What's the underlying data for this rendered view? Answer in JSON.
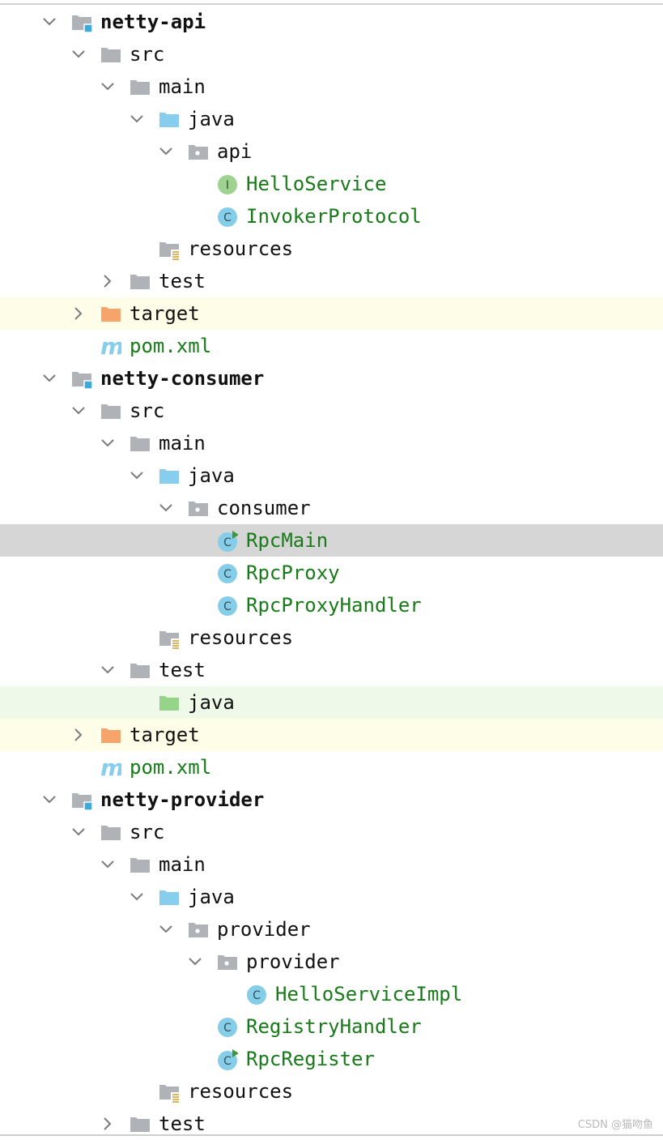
{
  "tree": [
    {
      "label": "netty-api",
      "level": 0,
      "arrow": "down",
      "icon": "module-folder",
      "style": "bold"
    },
    {
      "label": "src",
      "level": 1,
      "arrow": "down",
      "icon": "folder"
    },
    {
      "label": "main",
      "level": 2,
      "arrow": "down",
      "icon": "folder"
    },
    {
      "label": "java",
      "level": 3,
      "arrow": "down",
      "icon": "source-folder"
    },
    {
      "label": "api",
      "level": 4,
      "arrow": "down",
      "icon": "package-folder"
    },
    {
      "label": "HelloService",
      "level": 5,
      "arrow": "none",
      "icon": "interface-icon",
      "style": "class"
    },
    {
      "label": "InvokerProtocol",
      "level": 5,
      "arrow": "none",
      "icon": "class-icon",
      "style": "class"
    },
    {
      "label": "resources",
      "level": 3,
      "arrow": "none",
      "icon": "resources-folder"
    },
    {
      "label": "test",
      "level": 2,
      "arrow": "right",
      "icon": "folder"
    },
    {
      "label": "target",
      "level": 1,
      "arrow": "right",
      "icon": "excluded-folder",
      "highlight": "yellow"
    },
    {
      "label": "pom.xml",
      "level": 1,
      "arrow": "none",
      "icon": "maven-icon",
      "style": "class"
    },
    {
      "label": "netty-consumer",
      "level": 0,
      "arrow": "down",
      "icon": "module-folder",
      "style": "bold"
    },
    {
      "label": "src",
      "level": 1,
      "arrow": "down",
      "icon": "folder"
    },
    {
      "label": "main",
      "level": 2,
      "arrow": "down",
      "icon": "folder"
    },
    {
      "label": "java",
      "level": 3,
      "arrow": "down",
      "icon": "source-folder"
    },
    {
      "label": "consumer",
      "level": 4,
      "arrow": "down",
      "icon": "package-folder"
    },
    {
      "label": "RpcMain",
      "level": 5,
      "arrow": "none",
      "icon": "runnable-class-icon",
      "style": "class",
      "highlight": "selected"
    },
    {
      "label": "RpcProxy",
      "level": 5,
      "arrow": "none",
      "icon": "class-icon",
      "style": "class"
    },
    {
      "label": "RpcProxyHandler",
      "level": 5,
      "arrow": "none",
      "icon": "class-icon",
      "style": "class"
    },
    {
      "label": "resources",
      "level": 3,
      "arrow": "none",
      "icon": "resources-folder"
    },
    {
      "label": "test",
      "level": 2,
      "arrow": "down",
      "icon": "folder"
    },
    {
      "label": "java",
      "level": 3,
      "arrow": "none",
      "icon": "test-source-folder",
      "highlight": "green"
    },
    {
      "label": "target",
      "level": 1,
      "arrow": "right",
      "icon": "excluded-folder",
      "highlight": "yellow"
    },
    {
      "label": "pom.xml",
      "level": 1,
      "arrow": "none",
      "icon": "maven-icon",
      "style": "class"
    },
    {
      "label": "netty-provider",
      "level": 0,
      "arrow": "down",
      "icon": "module-folder",
      "style": "bold"
    },
    {
      "label": "src",
      "level": 1,
      "arrow": "down",
      "icon": "folder"
    },
    {
      "label": "main",
      "level": 2,
      "arrow": "down",
      "icon": "folder"
    },
    {
      "label": "java",
      "level": 3,
      "arrow": "down",
      "icon": "source-folder"
    },
    {
      "label": "provider",
      "level": 4,
      "arrow": "down",
      "icon": "package-folder"
    },
    {
      "label": "provider",
      "level": 5,
      "arrow": "down",
      "icon": "package-folder"
    },
    {
      "label": "HelloServiceImpl",
      "level": 6,
      "arrow": "none",
      "icon": "class-icon",
      "style": "class"
    },
    {
      "label": "RegistryHandler",
      "level": 5,
      "arrow": "none",
      "icon": "class-icon",
      "style": "class"
    },
    {
      "label": "RpcRegister",
      "level": 5,
      "arrow": "none",
      "icon": "runnable-class-icon",
      "style": "class"
    },
    {
      "label": "resources",
      "level": 3,
      "arrow": "none",
      "icon": "resources-folder"
    },
    {
      "label": "test",
      "level": 2,
      "arrow": "right",
      "icon": "folder"
    }
  ],
  "icon_glyphs": {
    "class": "C",
    "interface": "I",
    "maven": "m"
  },
  "watermark": "CSDN @猫吻鱼",
  "colors": {
    "folder": "#afb3b8",
    "source_folder": "#87cdee",
    "test_source_folder": "#96d48a",
    "excluded_folder": "#f6a46c",
    "module_badge": "#3aa9dc",
    "class_circle": "#86cde8",
    "interface_circle": "#9fd28f",
    "run_badge": "#3a9a3a",
    "resources_lines": "#d1a33a",
    "class_text": "#187a18"
  }
}
